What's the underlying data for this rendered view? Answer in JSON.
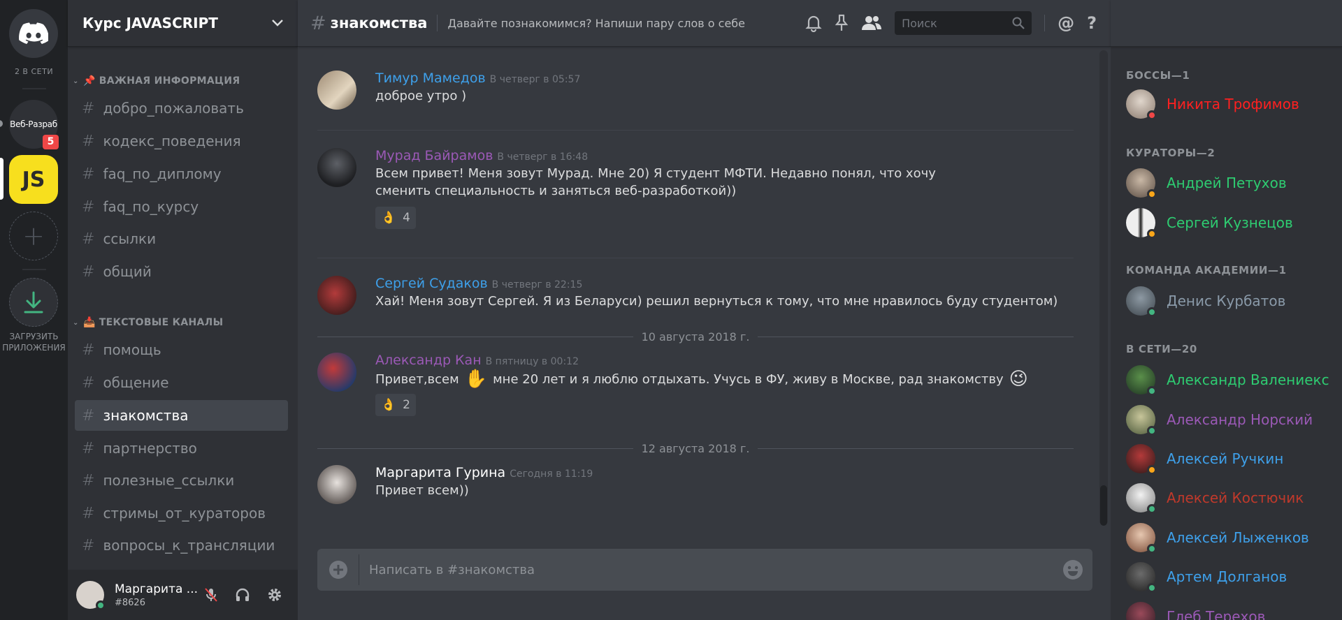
{
  "colors": {
    "online": "#43b581",
    "idle": "#faa61a",
    "dnd": "#f04747",
    "blue": "#3ea0ea",
    "purple": "#9b59b6",
    "green": "#2ecc71",
    "red": "#ff2020",
    "brick": "#c0392b",
    "grey": "#8a9aa9"
  },
  "rail": {
    "online_count": "2 В СЕТИ",
    "web_server_label": "Веб-Разраб",
    "web_badge": "5",
    "js_server_label": "JS",
    "add_symbol": "+",
    "download_label_1": "ЗАГРУЗИТЬ",
    "download_label_2": "ПРИЛОЖЕНИЯ"
  },
  "guild": {
    "name": "Курс JAVASCRIPT"
  },
  "categories": [
    {
      "label": "ВАЖНАЯ ИНФОРМАЦИЯ",
      "icon": "📌"
    },
    {
      "label": "ТЕКСТОВЫЕ КАНАЛЫ",
      "icon": "📥"
    }
  ],
  "channels": [
    "добро_пожаловать",
    "кодекс_поведения",
    "faq_по_диплому",
    "faq_по_курсу",
    "ссылки",
    "общий",
    "помощь",
    "общение",
    "знакомства",
    "партнерство",
    "полезные_ссылки",
    "стримы_от_кураторов",
    "вопросы_к_трансляции"
  ],
  "user": {
    "name": "Маргарита ...",
    "tag": "#8626"
  },
  "chat": {
    "channel": "знакомства",
    "topic": "Давайте познакомимся? Напиши пару слов о себе",
    "search_placeholder": "Поиск",
    "composer_placeholder": "Написать в #знакомства",
    "messages": [
      {
        "author": "Тимур Мамедов",
        "time": "В четверг в 05:57",
        "text": "доброе утро )"
      },
      {
        "author": "Мурад Байрамов",
        "time": "В четверг в 16:48",
        "text": "Всем привет! Меня зовут Мурад. Мне 20) Я студент МФТИ. Недавно понял, что хочу сменить специальность и заняться веб-разработкой))",
        "reaction": "👌",
        "reaction_count": "4"
      },
      {
        "author": "Сергей Судаков",
        "time": "В четверг в 22:15",
        "text": "Хай! Меня зовут Сергей. Я из Беларуси) решил вернуться к тому, что мне нравилось буду студентом)"
      },
      {
        "author": "Александр Кан",
        "time": "В пятницу в 00:12",
        "text_a": "Привет,всем",
        "emoji_a": "✋",
        "text_b": "мне 20 лет и я люблю отдыхать. Учусь в ФУ, живу в Москве, рад знакомству",
        "emoji_b": "😉",
        "reaction": "👌",
        "reaction_count": "2"
      },
      {
        "author": "Маргарита Гурина",
        "time": "Сегодня в 11:19",
        "text": "Привет всем))"
      }
    ],
    "date_1": "10 августа 2018 г.",
    "date_2": "12 августа 2018 г."
  },
  "members": {
    "groups": [
      "БОССЫ—1",
      "КУРАТОРЫ—2",
      "КОМАНДА АКАДЕМИИ—1",
      "В СЕТИ—20"
    ],
    "list": [
      "Никита Трофимов",
      "Андрей Петухов",
      "Сергей Кузнецов",
      "Денис Курбатов",
      "Александр Валениекс",
      "Александр Норский",
      "Алексей Ручкин",
      "Алексей Костючик",
      "Алексей Лыженков",
      "Артем Долганов",
      "Глеб Терехов"
    ]
  }
}
